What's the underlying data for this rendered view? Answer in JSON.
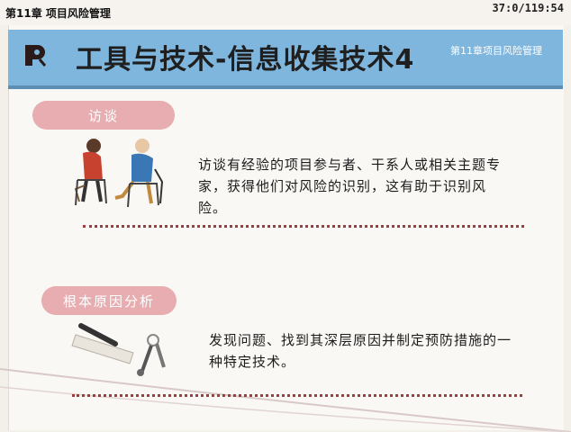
{
  "top_bar": {
    "chapter_heading": "第11章 项目风险管理",
    "page_counter": "37:0/119:54"
  },
  "header": {
    "title": "工具与技术-信息收集技术4",
    "chapter_label": "第11章项目风险管理",
    "logo_icon": "p-logo-icon"
  },
  "sections": [
    {
      "label": "访谈",
      "text": "访谈有经验的项目参与者、干系人或相关主题专家，获得他们对风险的识别，这有助于识别风险。",
      "illustration": "interview-illustration"
    },
    {
      "label": "根本原因分析",
      "text": "发现问题、找到其深层原因并制定预防措施的一种特定技术。",
      "illustration": "keys-illustration"
    }
  ],
  "colors": {
    "header_band": "#7fb6dd",
    "pill": "#e7adb0",
    "divider": "#a23c3c",
    "background": "#f3efe9"
  }
}
